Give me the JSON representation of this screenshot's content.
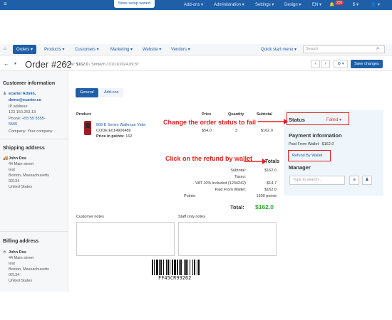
{
  "topbar": {
    "menu_glyph": "≡",
    "wizard_label": "Store setup wizard",
    "addons": "Add-ons ▾",
    "administration": "Administration ▾",
    "settings": "Settings ▾",
    "design": "Design ▾",
    "language": "EN ▾",
    "notifications_count": "250",
    "currency": "$ ▾",
    "user": "▾"
  },
  "menubar": {
    "home_glyph": "⌂",
    "items": [
      "Orders ▾",
      "Products ▾",
      "Customers ▾",
      "Marketing ▾",
      "Website ▾",
      "Vendors ▾"
    ],
    "quick_start": "Quick start menu ▾",
    "search_placeholder": "Search"
  },
  "title": {
    "back_glyph": "←",
    "order_title": "Order #262",
    "total_label": "Total:",
    "total_value": "$162.0",
    "meta": "/ Simtech / 01/11/2024,09:37",
    "prev": "‹",
    "next": "›",
    "gear": "⚙ ▾",
    "save_label": "Save changes"
  },
  "customer": {
    "heading": "Customer information",
    "name": "ecarter Admin,",
    "email": "demo@ecarter.co",
    "ip_label": "IP address:",
    "ip": "122.160.253.13",
    "phone_label": "Phone:",
    "phone": "+55 55 5555-",
    "phone2": "5555",
    "company": "Company: Your company"
  },
  "shipping": {
    "heading": "Shipping address",
    "name": "John Doe",
    "lines": [
      "44 Main street",
      "test",
      "Boston, Massachusetts",
      "02134",
      "United States"
    ]
  },
  "billing": {
    "heading": "Billing address",
    "name": "John Doe",
    "lines": [
      "44 Main street",
      "test",
      "Boston, Massachusetts",
      "02134",
      "United States"
    ]
  },
  "tabs": {
    "general": "General",
    "addons": "Add-ons"
  },
  "table": {
    "headers": [
      "Product",
      "Price",
      "Quantity",
      "Subtotal"
    ],
    "product_name": "808 E Series Walkman Vider",
    "product_code": "CODE:E014900489",
    "points_label": "Price in points:",
    "points_value": "162",
    "price": "$54.0",
    "quantity": "3",
    "subtotal": "$162.0"
  },
  "totals": {
    "heading": "Totals",
    "rows": [
      {
        "label": "Subtotal:",
        "value": "$162.0"
      },
      {
        "label": "Taxes:",
        "value": ""
      },
      {
        "label": "· VAT 10% included (1234242)",
        "value": "$14.7"
      },
      {
        "label": "Paid From Wallet:",
        "value": "$162.0"
      },
      {
        "label": "Points:",
        "value": "1500 points"
      }
    ],
    "total_label": "Total:",
    "total_value": "$162.0"
  },
  "status": {
    "label": "Status",
    "value": "Failed ▾",
    "payment_heading": "Payment information",
    "paid_from_wallet": "Paid From Wallet:  $162.0",
    "refund_button": "Refund By Wallet",
    "manager_heading": "Manager",
    "manager_placeholder": "Type to search..."
  },
  "notes": {
    "customer_label": "Customer notes",
    "staff_label": "Staff only notes"
  },
  "annotations": {
    "status_hint": "Change the order status to fail",
    "refund_hint": "Click on the refund by wallet"
  },
  "barcode_text": "FF45CR99262",
  "colors": {
    "accent": "#1e5fa8",
    "annotation": "#e02020",
    "total": "#2eaa3a",
    "failed": "#e53935"
  }
}
